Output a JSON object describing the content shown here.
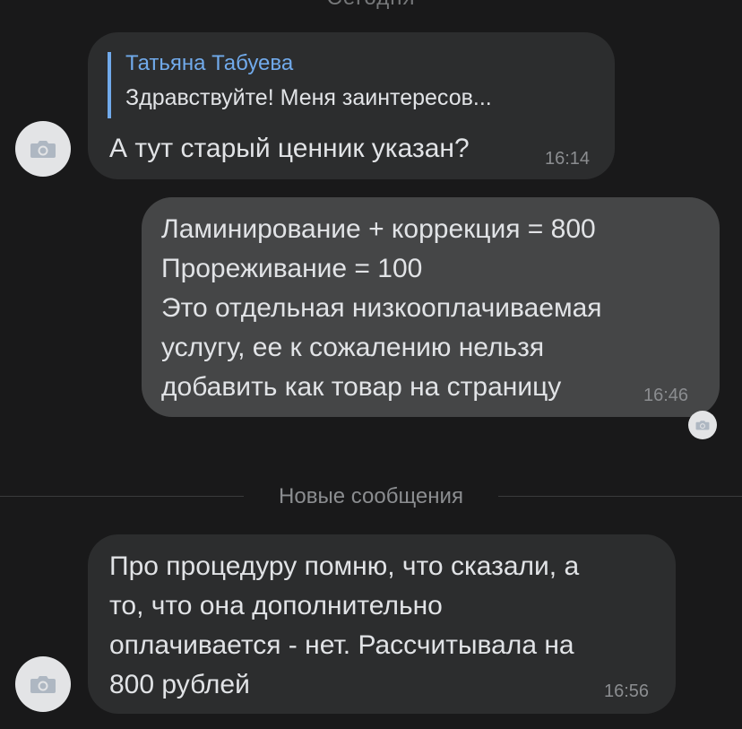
{
  "date_separator": "Сегодня",
  "messages": [
    {
      "direction": "incoming",
      "reply": {
        "author": "Татьяна Табуева",
        "text": "Здравствуйте! Меня заинтересов..."
      },
      "text": "А тут старый ценник указан?",
      "time": "16:14"
    },
    {
      "direction": "outgoing",
      "text": "Ламинирование + коррекция = 800\nПрореживание = 100\nЭто отдельная низкооплачиваемая\nуслугу, ее к сожалению нельзя\nдобавить как товар на страницу",
      "time": "16:46"
    },
    {
      "direction": "incoming",
      "text": "Про процедуру помню, что сказали, а\nто, что она дополнительно\nоплачивается - нет. Рассчитывала на\n800 рублей",
      "time": "16:56"
    }
  ],
  "new_messages_label": "Новые сообщения",
  "icons": {
    "avatar": "camera-icon"
  },
  "colors": {
    "background": "#19191a",
    "incoming_bubble": "#2c2d2e",
    "outgoing_bubble": "#454647",
    "accent": "#71aaeb"
  }
}
